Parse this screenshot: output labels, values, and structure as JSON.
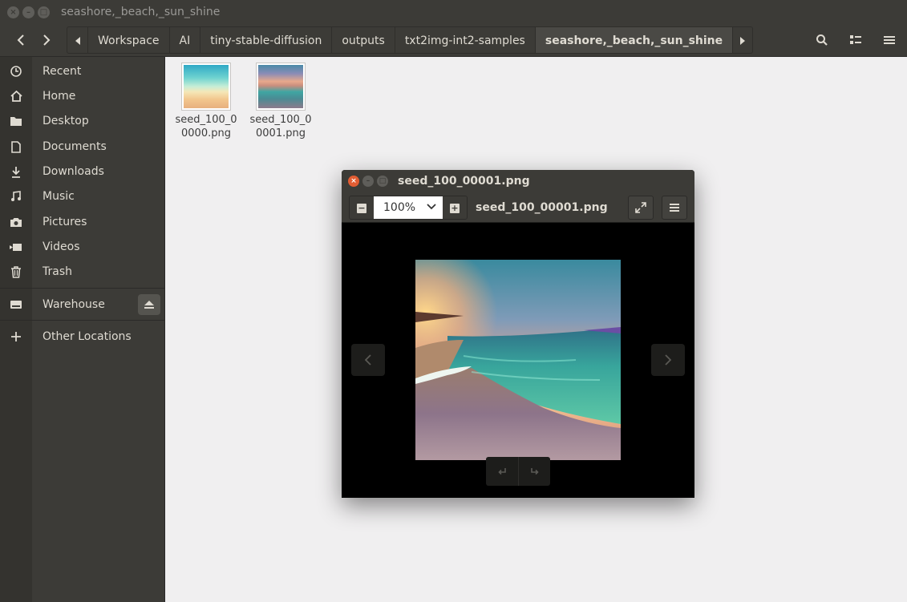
{
  "window": {
    "title": "seashore,_beach,_sun_shine"
  },
  "header": {
    "breadcrumbs": [
      "Workspace",
      "AI",
      "tiny-stable-diffusion",
      "outputs",
      "txt2img-int2-samples",
      "seashore,_beach,_sun_shine"
    ]
  },
  "sidebar": {
    "items": [
      {
        "label": "Recent",
        "icon": "clock-icon"
      },
      {
        "label": "Home",
        "icon": "home-icon"
      },
      {
        "label": "Desktop",
        "icon": "folder-icon"
      },
      {
        "label": "Documents",
        "icon": "document-icon"
      },
      {
        "label": "Downloads",
        "icon": "download-icon"
      },
      {
        "label": "Music",
        "icon": "music-icon"
      },
      {
        "label": "Pictures",
        "icon": "camera-icon"
      },
      {
        "label": "Videos",
        "icon": "video-icon"
      },
      {
        "label": "Trash",
        "icon": "trash-icon"
      }
    ],
    "devices": [
      {
        "label": "Warehouse",
        "icon": "drive-icon"
      }
    ],
    "other": {
      "label": "Other Locations",
      "icon": "plus-icon"
    }
  },
  "files": [
    {
      "name": "seed_100_00000.png"
    },
    {
      "name": "seed_100_00001.png"
    }
  ],
  "viewer": {
    "title": "seed_100_00001.png",
    "zoom": "100%",
    "filename": "seed_100_00001.png"
  },
  "colors": {
    "chrome": "#3c3b37",
    "close_button": "#e25d33",
    "content_bg": "#f0eff0"
  }
}
